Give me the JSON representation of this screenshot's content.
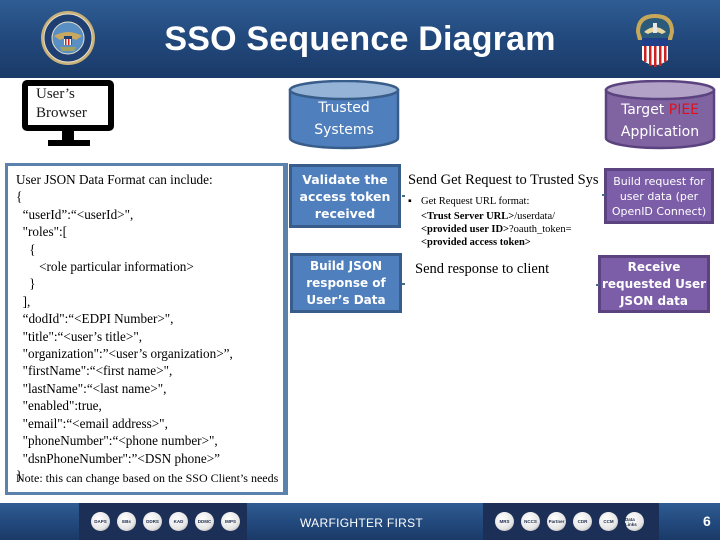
{
  "header": {
    "title": "SSO Sequence Diagram",
    "left_logo": "dod-seal-icon",
    "right_logo": "dla-seal-icon"
  },
  "actors": {
    "browser": {
      "label_line1": "User’s",
      "label_line2": "Browser",
      "icon": "monitor-icon"
    },
    "trusted": {
      "label_line1": "Trusted",
      "label_line2": "Systems",
      "color": "#4f7fbd"
    },
    "target": {
      "label_prefix": "Target ",
      "label_highlight": "PIEE",
      "label_line2": "Application",
      "color": "#7b5ea7",
      "highlight_color": "#e0101a"
    }
  },
  "json_panel": {
    "lines": [
      "User JSON Data Format can include:",
      "{",
      "  “userId”:“<userId>\",",
      "  \"roles\":[",
      "    {",
      "       <role particular information>",
      "    }",
      "  ],",
      "  “dodId\":“<EDPI Number>\",",
      "  \"title\":“<user’s title>\",",
      "  \"organization\":”<user’s organization>”,",
      "  \"firstName\":“<first name>\",",
      "  \"lastName\":“<last name>\",",
      "  \"enabled\":true,",
      "  \"email\":“<email address>\",",
      "  \"phoneNumber\":“<phone number>\",",
      "  \"dsnPhoneNumber\":”<DSN phone>”",
      "}"
    ],
    "note": "Note: this can change based on the SSO Client’s needs"
  },
  "steps": {
    "validate": {
      "line1": "Validate the",
      "line2": "access token",
      "line3": "received"
    },
    "build_json": {
      "line1": "Build JSON",
      "line2": "response of",
      "line3": "User’s Data"
    },
    "build_request": {
      "line1": "Build request for",
      "line2": "user data (per",
      "line3": "OpenID Connect)"
    },
    "receive": {
      "line1": "Receive",
      "line2": "requested User",
      "line3": "JSON data"
    }
  },
  "messages": {
    "get_request": {
      "title": "Send Get Request to Trusted Sys",
      "bullet": "Get Request URL format:",
      "url_part1_bold": "<Trust Server URL>",
      "url_part1_rest": "/userdata/",
      "url_part2_bold": "<provided user ID>",
      "url_part2_rest": "?oauth_token=",
      "url_part3_bold": "<provided access token>"
    },
    "response": {
      "title": "Send response to client"
    }
  },
  "footer": {
    "text": "WARFIGHTER FIRST",
    "page_number": "6",
    "left_seals": [
      "DAPS",
      "EBs",
      "DDRS",
      "KAD",
      "DDMC",
      "IMPS"
    ],
    "right_seals": [
      "MRS",
      "NCCS",
      "Partner",
      "CDR",
      "CCM",
      "Data Links"
    ]
  }
}
